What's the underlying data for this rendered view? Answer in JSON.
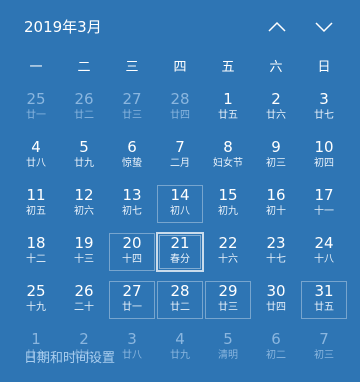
{
  "header": {
    "title": "2019年3月"
  },
  "weekdays": [
    "一",
    "二",
    "三",
    "四",
    "五",
    "六",
    "日"
  ],
  "days": [
    {
      "day": "25",
      "lunar": "廿一",
      "other": true
    },
    {
      "day": "26",
      "lunar": "廿二",
      "other": true
    },
    {
      "day": "27",
      "lunar": "廿三",
      "other": true
    },
    {
      "day": "28",
      "lunar": "廿四",
      "other": true
    },
    {
      "day": "1",
      "lunar": "廿五"
    },
    {
      "day": "2",
      "lunar": "廿六"
    },
    {
      "day": "3",
      "lunar": "廿七"
    },
    {
      "day": "4",
      "lunar": "廿八"
    },
    {
      "day": "5",
      "lunar": "廿九"
    },
    {
      "day": "6",
      "lunar": "惊蛰"
    },
    {
      "day": "7",
      "lunar": "二月"
    },
    {
      "day": "8",
      "lunar": "妇女节"
    },
    {
      "day": "9",
      "lunar": "初三"
    },
    {
      "day": "10",
      "lunar": "初四"
    },
    {
      "day": "11",
      "lunar": "初五"
    },
    {
      "day": "12",
      "lunar": "初六"
    },
    {
      "day": "13",
      "lunar": "初七"
    },
    {
      "day": "14",
      "lunar": "初八"
    },
    {
      "day": "15",
      "lunar": "初九"
    },
    {
      "day": "16",
      "lunar": "初十"
    },
    {
      "day": "17",
      "lunar": "十一"
    },
    {
      "day": "18",
      "lunar": "十二"
    },
    {
      "day": "19",
      "lunar": "十三"
    },
    {
      "day": "20",
      "lunar": "十四"
    },
    {
      "day": "21",
      "lunar": "春分",
      "today": true
    },
    {
      "day": "22",
      "lunar": "十六"
    },
    {
      "day": "23",
      "lunar": "十七"
    },
    {
      "day": "24",
      "lunar": "十八"
    },
    {
      "day": "25",
      "lunar": "十九"
    },
    {
      "day": "26",
      "lunar": "二十"
    },
    {
      "day": "27",
      "lunar": "廿一"
    },
    {
      "day": "28",
      "lunar": "廿二"
    },
    {
      "day": "29",
      "lunar": "廿三"
    },
    {
      "day": "30",
      "lunar": "廿四"
    },
    {
      "day": "31",
      "lunar": "廿五"
    },
    {
      "day": "1",
      "lunar": "廿六",
      "other": true
    },
    {
      "day": "2",
      "lunar": "廿七",
      "other": true
    },
    {
      "day": "3",
      "lunar": "廿八",
      "other": true
    },
    {
      "day": "4",
      "lunar": "廿九",
      "other": true
    },
    {
      "day": "5",
      "lunar": "清明",
      "other": true
    },
    {
      "day": "6",
      "lunar": "初二",
      "other": true
    },
    {
      "day": "7",
      "lunar": "初三",
      "other": true
    }
  ],
  "footer": {
    "settings_link": "日期和时间设置"
  }
}
